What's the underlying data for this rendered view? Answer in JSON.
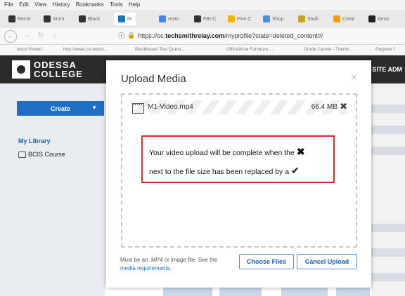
{
  "menubar": [
    "File",
    "Edit",
    "View",
    "History",
    "Bookmarks",
    "Tools",
    "Help"
  ],
  "tabs": [
    "Recor",
    "Amm",
    "Black",
    "M",
    "resto",
    "FBI-C",
    "Five C",
    "Shop",
    "Studi",
    "Creat",
    "Amor"
  ],
  "nav": {
    "url_prefix": "https://oc.",
    "url_domain": "techsmithrelay.com",
    "url_rest": "/myprofile?state=deleted_content#/"
  },
  "bookmarks": [
    "Most Visited",
    "http://www.csi.edu/tr...",
    "Blackboard Test Quest...",
    "OfficeWise Furniture ...",
    "Grade Center - Trainin...",
    "Register f"
  ],
  "header": {
    "logo_line1": "ODESSA",
    "logo_line2": "COLLEGE",
    "site_admin": "SITE ADM"
  },
  "sidebar": {
    "create_label": "Create",
    "caret": "▼",
    "my_library": "My Library",
    "folder": "BCIS Course"
  },
  "modal": {
    "title": "Upload Media",
    "close": "×",
    "file_name": "M1-Video.mp4",
    "file_size": "66.4 MB",
    "file_remove": "✖",
    "note_line1": "Your video upload will be complete when the",
    "note_x": "✖",
    "note_line2": "next to the file size has been replaced by a",
    "note_check": "✔",
    "footer_text": "Must be an .MP4 or image file. See the",
    "footer_link": "media requirements.",
    "choose_files": "Choose Files",
    "cancel_upload": "Cancel Upload"
  },
  "colors": {
    "accent": "#1e6fc4",
    "header": "#2b2b2b",
    "note_border": "#d32f2f"
  }
}
